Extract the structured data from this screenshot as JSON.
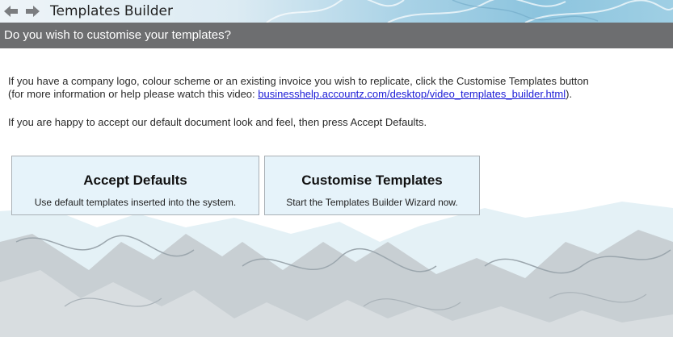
{
  "window": {
    "title": "Templates Builder",
    "back_icon": "back-arrow-icon",
    "forward_icon": "forward-arrow-icon"
  },
  "header": {
    "heading": "Do you wish to customise your templates?"
  },
  "content": {
    "line1": "If you have a company logo, colour scheme or an existing invoice you wish to replicate, click the Customise Templates button",
    "line2_prefix": "(for more information or help please watch this video: ",
    "video_link": "businesshelp.accountz.com/desktop/video_templates_builder.html",
    "line2_suffix": ").",
    "line3": "If you are happy to accept our default document look and feel, then press Accept Defaults."
  },
  "buttons": {
    "accept": {
      "title": "Accept Defaults",
      "subtitle": "Use default templates inserted into the system."
    },
    "customise": {
      "title": "Customise Templates",
      "subtitle": "Start the Templates Builder Wizard now."
    }
  },
  "colors": {
    "header_band": "#6d6e70",
    "button_bg": "#e6f3fa",
    "link": "#1b1bd6"
  }
}
